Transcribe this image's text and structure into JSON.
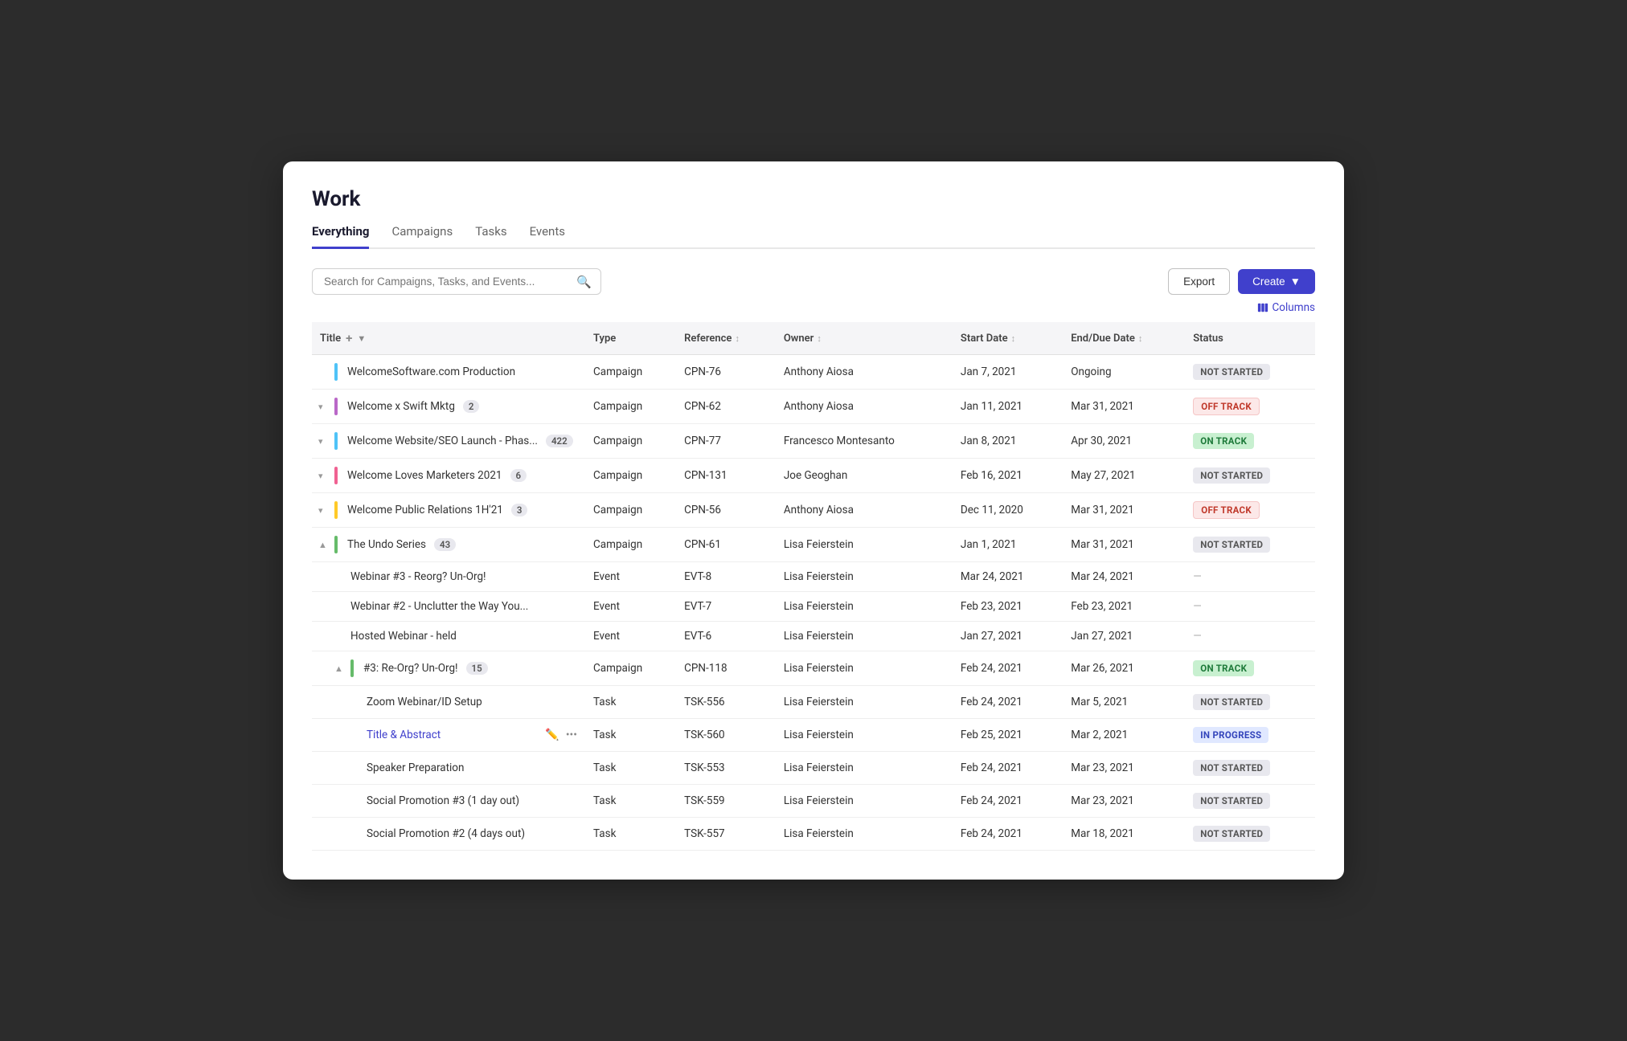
{
  "page": {
    "title": "Work",
    "tabs": [
      {
        "label": "Everything",
        "active": true
      },
      {
        "label": "Campaigns",
        "active": false
      },
      {
        "label": "Tasks",
        "active": false
      },
      {
        "label": "Events",
        "active": false
      }
    ]
  },
  "toolbar": {
    "search_placeholder": "Search for Campaigns, Tasks, and Events...",
    "export_label": "Export",
    "create_label": "Create",
    "columns_label": "Columns"
  },
  "table": {
    "columns": [
      {
        "key": "title",
        "label": "Title"
      },
      {
        "key": "type",
        "label": "Type"
      },
      {
        "key": "reference",
        "label": "Reference"
      },
      {
        "key": "owner",
        "label": "Owner"
      },
      {
        "key": "start_date",
        "label": "Start Date"
      },
      {
        "key": "end_due_date",
        "label": "End/Due Date"
      },
      {
        "key": "status",
        "label": "Status"
      }
    ],
    "rows": [
      {
        "id": 1,
        "title": "WelcomeSoftware.com Production",
        "indent": 0,
        "has_chevron": false,
        "chevron_open": false,
        "bar_color": "#4fc3f7",
        "type": "Campaign",
        "reference": "CPN-76",
        "owner": "Anthony Aiosa",
        "start_date": "Jan 7, 2021",
        "end_due_date": "Ongoing",
        "status": "NOT STARTED",
        "status_class": "status-not-started",
        "badge": null,
        "is_link": false,
        "show_actions": false
      },
      {
        "id": 2,
        "title": "Welcome x Swift Mktg",
        "indent": 0,
        "has_chevron": true,
        "chevron_open": false,
        "bar_color": "#ba68c8",
        "type": "Campaign",
        "reference": "CPN-62",
        "owner": "Anthony Aiosa",
        "start_date": "Jan 11, 2021",
        "end_due_date": "Mar 31, 2021",
        "status": "OFF TRACK",
        "status_class": "status-off-track",
        "badge": "2",
        "is_link": false,
        "show_actions": false
      },
      {
        "id": 3,
        "title": "Welcome Website/SEO Launch - Phas...",
        "indent": 0,
        "has_chevron": true,
        "chevron_open": false,
        "bar_color": "#4fc3f7",
        "type": "Campaign",
        "reference": "CPN-77",
        "owner": "Francesco Montesanto",
        "start_date": "Jan 8, 2021",
        "end_due_date": "Apr 30, 2021",
        "status": "ON TRACK",
        "status_class": "status-on-track",
        "badge": "422",
        "is_link": false,
        "show_actions": false
      },
      {
        "id": 4,
        "title": "Welcome Loves Marketers 2021",
        "indent": 0,
        "has_chevron": true,
        "chevron_open": false,
        "bar_color": "#f06292",
        "type": "Campaign",
        "reference": "CPN-131",
        "owner": "Joe Geoghan",
        "start_date": "Feb 16, 2021",
        "end_due_date": "May 27, 2021",
        "status": "NOT STARTED",
        "status_class": "status-not-started",
        "badge": "6",
        "is_link": false,
        "show_actions": false
      },
      {
        "id": 5,
        "title": "Welcome Public Relations 1H'21",
        "indent": 0,
        "has_chevron": true,
        "chevron_open": false,
        "bar_color": "#ffca28",
        "type": "Campaign",
        "reference": "CPN-56",
        "owner": "Anthony Aiosa",
        "start_date": "Dec 11, 2020",
        "end_due_date": "Mar 31, 2021",
        "status": "OFF TRACK",
        "status_class": "status-off-track",
        "badge": "3",
        "is_link": false,
        "show_actions": false
      },
      {
        "id": 6,
        "title": "The Undo Series",
        "indent": 0,
        "has_chevron": true,
        "chevron_open": true,
        "bar_color": "#66bb6a",
        "type": "Campaign",
        "reference": "CPN-61",
        "owner": "Lisa Feierstein",
        "start_date": "Jan 1, 2021",
        "end_due_date": "Mar 31, 2021",
        "status": "NOT STARTED",
        "status_class": "status-not-started",
        "badge": "43",
        "is_link": false,
        "show_actions": false
      },
      {
        "id": 7,
        "title": "Webinar #3 - Reorg? Un-Org!",
        "indent": 1,
        "has_chevron": false,
        "chevron_open": false,
        "bar_color": null,
        "type": "Event",
        "reference": "EVT-8",
        "owner": "Lisa Feierstein",
        "start_date": "Mar 24, 2021",
        "end_due_date": "Mar 24, 2021",
        "status": "—",
        "status_class": "status-dash",
        "badge": null,
        "is_link": false,
        "show_actions": false
      },
      {
        "id": 8,
        "title": "Webinar #2 - Unclutter the Way You...",
        "indent": 1,
        "has_chevron": false,
        "chevron_open": false,
        "bar_color": null,
        "type": "Event",
        "reference": "EVT-7",
        "owner": "Lisa Feierstein",
        "start_date": "Feb 23, 2021",
        "end_due_date": "Feb 23, 2021",
        "status": "—",
        "status_class": "status-dash",
        "badge": null,
        "is_link": false,
        "show_actions": false
      },
      {
        "id": 9,
        "title": "Hosted Webinar - held",
        "indent": 1,
        "has_chevron": false,
        "chevron_open": false,
        "bar_color": null,
        "type": "Event",
        "reference": "EVT-6",
        "owner": "Lisa Feierstein",
        "start_date": "Jan 27, 2021",
        "end_due_date": "Jan 27, 2021",
        "status": "—",
        "status_class": "status-dash",
        "badge": null,
        "is_link": false,
        "show_actions": false
      },
      {
        "id": 10,
        "title": "#3: Re-Org? Un-Org!",
        "indent": 1,
        "has_chevron": true,
        "chevron_open": true,
        "bar_color": "#66bb6a",
        "type": "Campaign",
        "reference": "CPN-118",
        "owner": "Lisa Feierstein",
        "start_date": "Feb 24, 2021",
        "end_due_date": "Mar 26, 2021",
        "status": "ON TRACK",
        "status_class": "status-on-track",
        "badge": "15",
        "is_link": false,
        "show_actions": false
      },
      {
        "id": 11,
        "title": "Zoom Webinar/ID Setup",
        "indent": 2,
        "has_chevron": false,
        "chevron_open": false,
        "bar_color": null,
        "type": "Task",
        "reference": "TSK-556",
        "owner": "Lisa Feierstein",
        "start_date": "Feb 24, 2021",
        "end_due_date": "Mar 5, 2021",
        "status": "NOT STARTED",
        "status_class": "status-not-started",
        "badge": null,
        "is_link": false,
        "show_actions": false
      },
      {
        "id": 12,
        "title": "Title & Abstract",
        "indent": 2,
        "has_chevron": false,
        "chevron_open": false,
        "bar_color": null,
        "type": "Task",
        "reference": "TSK-560",
        "owner": "Lisa Feierstein",
        "start_date": "Feb 25, 2021",
        "end_due_date": "Mar 2, 2021",
        "status": "IN PROGRESS",
        "status_class": "status-in-progress",
        "badge": null,
        "is_link": true,
        "show_actions": true
      },
      {
        "id": 13,
        "title": "Speaker Preparation",
        "indent": 2,
        "has_chevron": false,
        "chevron_open": false,
        "bar_color": null,
        "type": "Task",
        "reference": "TSK-553",
        "owner": "Lisa Feierstein",
        "start_date": "Feb 24, 2021",
        "end_due_date": "Mar 23, 2021",
        "status": "NOT STARTED",
        "status_class": "status-not-started",
        "badge": null,
        "is_link": false,
        "show_actions": false
      },
      {
        "id": 14,
        "title": "Social Promotion #3 (1 day out)",
        "indent": 2,
        "has_chevron": false,
        "chevron_open": false,
        "bar_color": null,
        "type": "Task",
        "reference": "TSK-559",
        "owner": "Lisa Feierstein",
        "start_date": "Feb 24, 2021",
        "end_due_date": "Mar 23, 2021",
        "status": "NOT STARTED",
        "status_class": "status-not-started",
        "badge": null,
        "is_link": false,
        "show_actions": false
      },
      {
        "id": 15,
        "title": "Social Promotion #2 (4 days out)",
        "indent": 2,
        "has_chevron": false,
        "chevron_open": false,
        "bar_color": null,
        "type": "Task",
        "reference": "TSK-557",
        "owner": "Lisa Feierstein",
        "start_date": "Feb 24, 2021",
        "end_due_date": "Mar 18, 2021",
        "status": "NOT STARTED",
        "status_class": "status-not-started",
        "badge": null,
        "is_link": false,
        "show_actions": false
      }
    ]
  }
}
